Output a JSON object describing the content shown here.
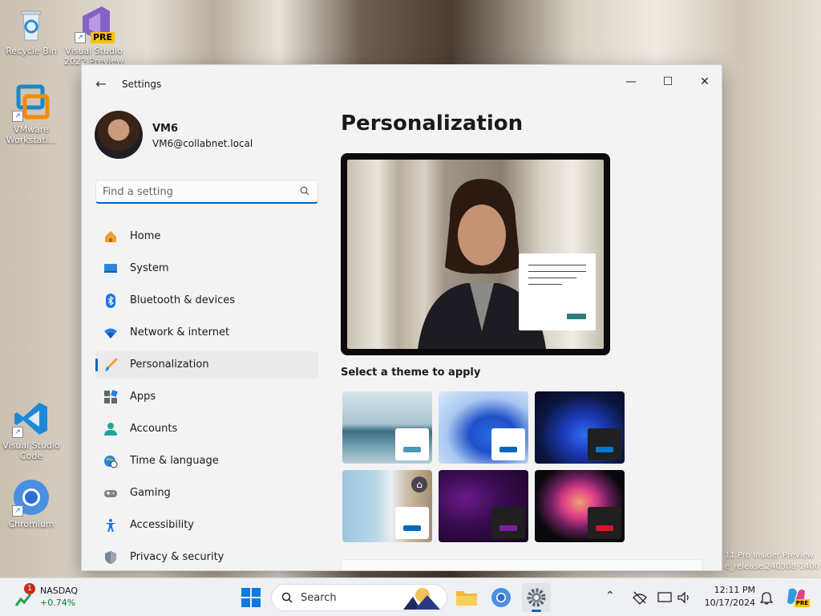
{
  "desktop": {
    "icons": [
      {
        "label": "Recycle Bin"
      },
      {
        "label": "Visual Studio 2022 Preview"
      },
      {
        "label": "VMware Workstati..."
      },
      {
        "label": "Visual Studio Code"
      },
      {
        "label": "Chromium"
      }
    ],
    "vs_badge": "PRE",
    "watermark_line1": "11 Pro Insider Preview",
    "watermark_line2": "e_release.240308-1400"
  },
  "window": {
    "title": "Settings",
    "controls": {
      "minimize": "—",
      "maximize": "☐",
      "close": "✕"
    },
    "profile": {
      "name": "VM6",
      "email": "VM6@collabnet.local"
    },
    "search": {
      "placeholder": "Find a setting"
    },
    "nav": [
      {
        "label": "Home",
        "icon": "home-icon"
      },
      {
        "label": "System",
        "icon": "system-icon"
      },
      {
        "label": "Bluetooth & devices",
        "icon": "bluetooth-icon"
      },
      {
        "label": "Network & internet",
        "icon": "wifi-icon"
      },
      {
        "label": "Personalization",
        "icon": "brush-icon",
        "active": true
      },
      {
        "label": "Apps",
        "icon": "apps-icon"
      },
      {
        "label": "Accounts",
        "icon": "accounts-icon"
      },
      {
        "label": "Time & language",
        "icon": "globe-clock-icon"
      },
      {
        "label": "Gaming",
        "icon": "gamepad-icon"
      },
      {
        "label": "Accessibility",
        "icon": "accessibility-icon"
      },
      {
        "label": "Privacy & security",
        "icon": "shield-icon"
      }
    ],
    "page_title": "Personalization",
    "theme_heading": "Select a theme to apply",
    "themes": [
      {
        "name": "theme-glow-lake",
        "card_color": "#ffffff",
        "bar_color": "#4a9bb8"
      },
      {
        "name": "theme-windows-light",
        "card_color": "#ffffff",
        "bar_color": "#0067c0"
      },
      {
        "name": "theme-windows-dark",
        "card_color": "#202020",
        "bar_color": "#0078d4"
      },
      {
        "name": "theme-captured-motion",
        "card_color": "#ffffff",
        "bar_color": "#0067c0"
      },
      {
        "name": "theme-glow",
        "card_color": "#202020",
        "bar_color": "#7a1fa2"
      },
      {
        "name": "theme-flow",
        "card_color": "#202020",
        "bar_color": "#d1182d"
      }
    ]
  },
  "taskbar": {
    "stock": {
      "name": "NASDAQ",
      "change": "+0.74%",
      "badge": "1"
    },
    "search_label": "Search",
    "time": "12:11 PM",
    "date": "10/17/2024",
    "copilot_badge": "PRE"
  }
}
